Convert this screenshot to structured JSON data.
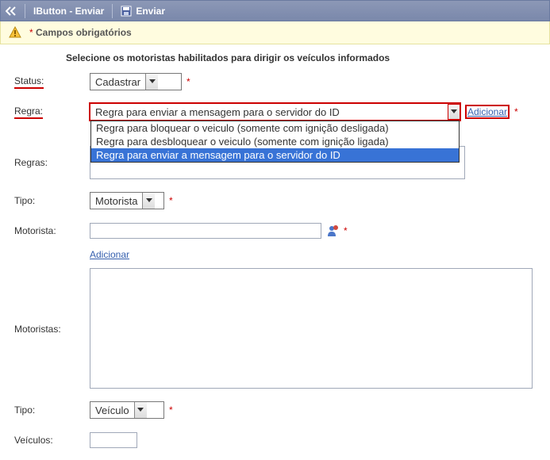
{
  "header": {
    "title": "IButton - Enviar",
    "send_label": "Enviar"
  },
  "warning": {
    "text": "Campos obrigatórios",
    "mark": "*"
  },
  "instruction": "Selecione os motoristas habilitados para dirigir os veículos informados",
  "labels": {
    "status": "Status:",
    "regra": "Regra:",
    "regras": "Regras:",
    "tipo1": "Tipo:",
    "motorista": "Motorista:",
    "motoristas": "Motoristas:",
    "tipo2": "Tipo:",
    "veiculos": "Veículos:"
  },
  "status": {
    "value": "Cadastrar"
  },
  "regra": {
    "value": "Regra para enviar a mensagem para o servidor do ID",
    "adicionar": "Adicionar",
    "options": {
      "o1": "Regra para bloquear o veiculo (somente com ignição desligada)",
      "o2": "Regra para desbloquear o veiculo (somente com ignição ligada)",
      "o3": "Regra para enviar a mensagem para o servidor do ID"
    }
  },
  "tipo1": {
    "value": "Motorista"
  },
  "motorista": {
    "value": "",
    "adicionar": "Adicionar"
  },
  "tipo2": {
    "value": "Veículo"
  },
  "veiculos": {
    "value": ""
  },
  "req_mark": "*"
}
